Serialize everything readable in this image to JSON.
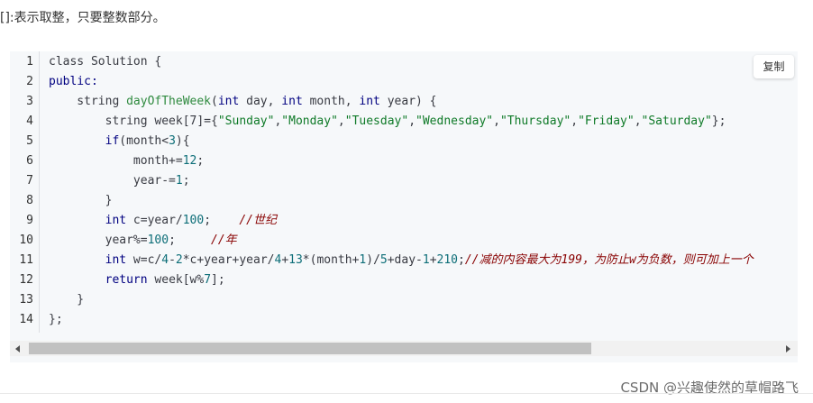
{
  "intro_text": "[]:表示取整，只要整数部分。",
  "copy_label": "复制",
  "line_numbers": [
    "1",
    "2",
    "3",
    "4",
    "5",
    "6",
    "7",
    "8",
    "9",
    "10",
    "11",
    "12",
    "13",
    "14"
  ],
  "code_lines": [
    [
      {
        "t": "class Solution {",
        "c": "plain"
      }
    ],
    [
      {
        "t": "public:",
        "c": "kw"
      }
    ],
    [
      {
        "t": "    string ",
        "c": "plain"
      },
      {
        "t": "dayOfTheWeek",
        "c": "fn"
      },
      {
        "t": "(",
        "c": "plain"
      },
      {
        "t": "int",
        "c": "kw"
      },
      {
        "t": " day, ",
        "c": "plain"
      },
      {
        "t": "int",
        "c": "kw"
      },
      {
        "t": " month, ",
        "c": "plain"
      },
      {
        "t": "int",
        "c": "kw"
      },
      {
        "t": " year) {",
        "c": "plain"
      }
    ],
    [
      {
        "t": "        string week[7]={",
        "c": "plain"
      },
      {
        "t": "\"Sunday\"",
        "c": "str"
      },
      {
        "t": ",",
        "c": "plain"
      },
      {
        "t": "\"Monday\"",
        "c": "str"
      },
      {
        "t": ",",
        "c": "plain"
      },
      {
        "t": "\"Tuesday\"",
        "c": "str"
      },
      {
        "t": ",",
        "c": "plain"
      },
      {
        "t": "\"Wednesday\"",
        "c": "str"
      },
      {
        "t": ",",
        "c": "plain"
      },
      {
        "t": "\"Thursday\"",
        "c": "str"
      },
      {
        "t": ",",
        "c": "plain"
      },
      {
        "t": "\"Friday\"",
        "c": "str"
      },
      {
        "t": ",",
        "c": "plain"
      },
      {
        "t": "\"Saturday\"",
        "c": "str"
      },
      {
        "t": "};",
        "c": "plain"
      }
    ],
    [
      {
        "t": "        ",
        "c": "plain"
      },
      {
        "t": "if",
        "c": "kw"
      },
      {
        "t": "(month<",
        "c": "plain"
      },
      {
        "t": "3",
        "c": "num"
      },
      {
        "t": "){",
        "c": "plain"
      }
    ],
    [
      {
        "t": "            month+=",
        "c": "plain"
      },
      {
        "t": "12",
        "c": "num"
      },
      {
        "t": ";",
        "c": "plain"
      }
    ],
    [
      {
        "t": "            year-=",
        "c": "plain"
      },
      {
        "t": "1",
        "c": "num"
      },
      {
        "t": ";",
        "c": "plain"
      }
    ],
    [
      {
        "t": "        }",
        "c": "plain"
      }
    ],
    [
      {
        "t": "        ",
        "c": "plain"
      },
      {
        "t": "int",
        "c": "kw"
      },
      {
        "t": " c=year/",
        "c": "plain"
      },
      {
        "t": "100",
        "c": "num"
      },
      {
        "t": ";    ",
        "c": "plain"
      },
      {
        "t": "//世纪",
        "c": "cmt"
      }
    ],
    [
      {
        "t": "        year%=",
        "c": "plain"
      },
      {
        "t": "100",
        "c": "num"
      },
      {
        "t": ";     ",
        "c": "plain"
      },
      {
        "t": "//年",
        "c": "cmt"
      }
    ],
    [
      {
        "t": "        ",
        "c": "plain"
      },
      {
        "t": "int",
        "c": "kw"
      },
      {
        "t": " w=c/",
        "c": "plain"
      },
      {
        "t": "4",
        "c": "num"
      },
      {
        "t": "-",
        "c": "plain"
      },
      {
        "t": "2",
        "c": "num"
      },
      {
        "t": "*c+year+year/",
        "c": "plain"
      },
      {
        "t": "4",
        "c": "num"
      },
      {
        "t": "+",
        "c": "plain"
      },
      {
        "t": "13",
        "c": "num"
      },
      {
        "t": "*(month+",
        "c": "plain"
      },
      {
        "t": "1",
        "c": "num"
      },
      {
        "t": ")/",
        "c": "plain"
      },
      {
        "t": "5",
        "c": "num"
      },
      {
        "t": "+day-",
        "c": "plain"
      },
      {
        "t": "1",
        "c": "num"
      },
      {
        "t": "+",
        "c": "plain"
      },
      {
        "t": "210",
        "c": "num"
      },
      {
        "t": ";",
        "c": "plain"
      },
      {
        "t": "//减的内容最大为199，为防止w为负数，则可加上一个",
        "c": "cmt"
      }
    ],
    [
      {
        "t": "        ",
        "c": "plain"
      },
      {
        "t": "return",
        "c": "kw"
      },
      {
        "t": " week[w%",
        "c": "plain"
      },
      {
        "t": "7",
        "c": "num"
      },
      {
        "t": "];",
        "c": "plain"
      }
    ],
    [
      {
        "t": "    }",
        "c": "plain"
      }
    ],
    [
      {
        "t": "};",
        "c": "plain"
      }
    ]
  ],
  "scrollbar": {
    "thumb_fraction": 0.72
  },
  "watermark": "CSDN @兴趣使然的草帽路飞",
  "colors": {
    "keyword": "#000080",
    "function": "#2f8a3f",
    "string": "#0f7a28",
    "number": "#0d6e78",
    "comment": "#880000",
    "background": "#f6f8fa"
  }
}
